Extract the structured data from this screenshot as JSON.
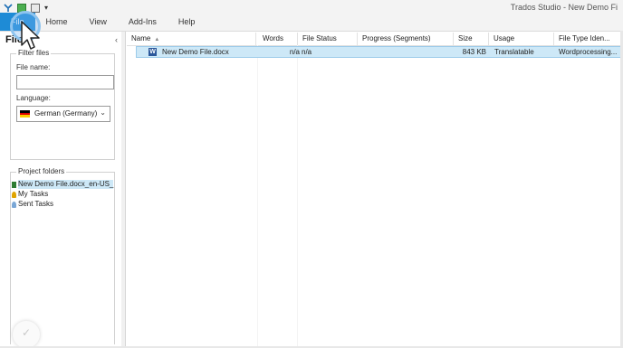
{
  "window": {
    "title": "Trados Studio - New Demo Fi"
  },
  "quick_access": {
    "items": [
      "app-logo-icon",
      "tm-icon",
      "save-icon"
    ],
    "dropdown_glyph": "▾"
  },
  "ribbon": {
    "tabs": [
      {
        "label": "File",
        "active": true
      },
      {
        "label": "Home"
      },
      {
        "label": "View"
      },
      {
        "label": "Add-Ins"
      },
      {
        "label": "Help"
      }
    ]
  },
  "navigation": {
    "title": "File",
    "collapse_glyph": "‹",
    "filter": {
      "legend": "Filter files",
      "file_name_label": "File name:",
      "file_name_value": "",
      "language_label": "Language:",
      "language_value": "German (Germany)",
      "language_chevron": "⌄"
    },
    "project_folders": {
      "legend": "Project folders",
      "items": [
        {
          "label": "New Demo File.docx_en-US_",
          "selected": true
        },
        {
          "label": "My Tasks"
        },
        {
          "label": "Sent Tasks"
        }
      ]
    }
  },
  "grid": {
    "columns": [
      "Name",
      "Words",
      "File Status",
      "Progress (Segments)",
      "Size",
      "Usage",
      "File Type Iden..."
    ],
    "sort_glyph": "▲",
    "rows": [
      {
        "name": "New Demo File.docx",
        "words": "n/a",
        "file_status": "n/a",
        "progress": "",
        "size": "843 KB",
        "usage": "Translatable",
        "file_type": "Wordprocessing..."
      }
    ]
  },
  "overlay": {
    "check_glyph": "✓"
  },
  "colors": {
    "accent": "#1e8bd6",
    "selection": "#cde8f7",
    "word_blue": "#2b579a"
  }
}
